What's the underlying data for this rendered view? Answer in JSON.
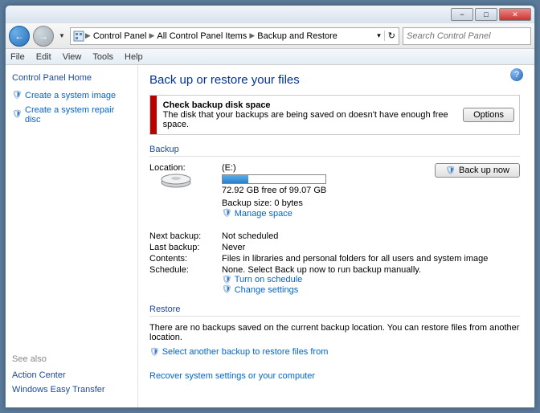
{
  "titlebar": {
    "min": "−",
    "max": "□",
    "close": "✕"
  },
  "nav": {
    "back": "←",
    "forward": "→",
    "path": [
      "Control Panel",
      "All Control Panel Items",
      "Backup and Restore"
    ],
    "refresh": "↻"
  },
  "search": {
    "placeholder": "Search Control Panel"
  },
  "menubar": [
    "File",
    "Edit",
    "View",
    "Tools",
    "Help"
  ],
  "sidebar": {
    "home": "Control Panel Home",
    "links": [
      "Create a system image",
      "Create a system repair disc"
    ],
    "seealso": "See also",
    "seelinks": [
      "Action Center",
      "Windows Easy Transfer"
    ]
  },
  "main": {
    "title": "Back up or restore your files",
    "alert": {
      "heading": "Check backup disk space",
      "text": "The disk that your backups are being saved on doesn't have enough free space.",
      "button": "Options"
    },
    "backup": {
      "section": "Backup",
      "location_label": "Location:",
      "location_value": "(E:)",
      "free_space": "72.92 GB free of 99.07 GB",
      "backup_size": "Backup size: 0 bytes",
      "manage_space": "Manage space",
      "backup_now": "Back up now",
      "next_label": "Next backup:",
      "next_value": "Not scheduled",
      "last_label": "Last backup:",
      "last_value": "Never",
      "contents_label": "Contents:",
      "contents_value": "Files in libraries and personal folders for all users and system image",
      "schedule_label": "Schedule:",
      "schedule_value": "None. Select Back up now to run backup manually.",
      "turn_on": "Turn on schedule",
      "change_settings": "Change settings"
    },
    "restore": {
      "section": "Restore",
      "text": "There are no backups saved on the current backup location. You can restore files from another location.",
      "select_link": "Select another backup to restore files from",
      "recover": "Recover system settings or your computer"
    }
  }
}
